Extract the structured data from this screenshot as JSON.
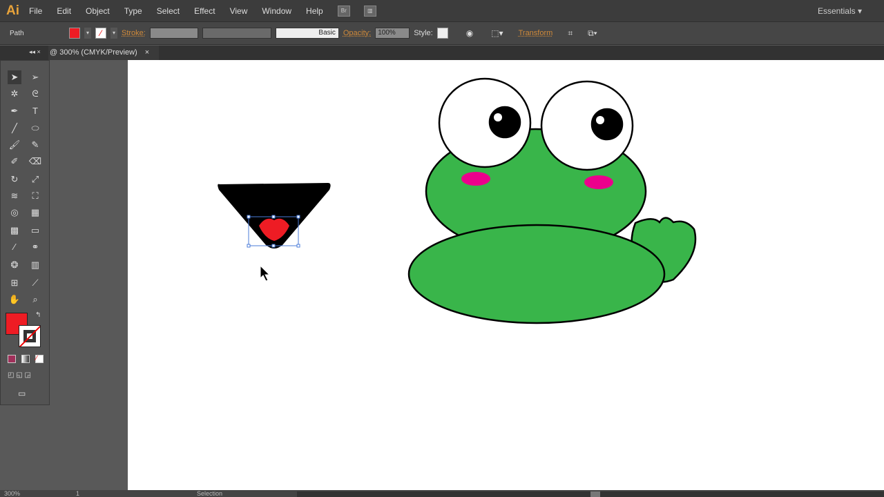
{
  "app": {
    "logo": "Ai",
    "workspace": "Essentials"
  },
  "menu": [
    "File",
    "Edit",
    "Object",
    "Type",
    "Select",
    "Effect",
    "View",
    "Window",
    "Help"
  ],
  "bridge_label": "Br",
  "control": {
    "selection_type": "Path",
    "stroke_label": "Stroke:",
    "brush": "Basic",
    "opacity_label": "Opacity:",
    "opacity": "100%",
    "style_label": "Style:",
    "transform": "Transform",
    "fill_color": "#ee1c24"
  },
  "document_tab": {
    "title": "@ 300% (CMYK/Preview)",
    "close": "×"
  },
  "status": {
    "zoom": "300%",
    "artboard": "1",
    "tool": "Selection"
  },
  "colors": {
    "frog_green": "#39b54a",
    "cheek": "#ec008c",
    "mouth": "#ee1c24"
  }
}
